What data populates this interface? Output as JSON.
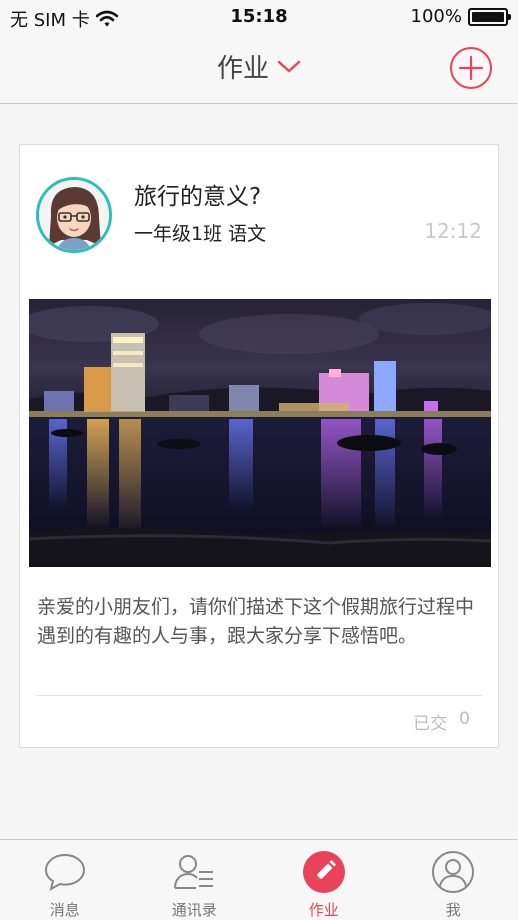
{
  "status_bar": {
    "carrier": "无 SIM 卡",
    "time": "15:18",
    "battery": "100%",
    "battery_level": 1.0
  },
  "nav": {
    "title": "作业",
    "icons": [
      "chevron-down-icon",
      "plus-circle-icon"
    ]
  },
  "card": {
    "title": "旅行的意义?",
    "meta": "一年级1班 语文",
    "time": "12:12",
    "description": "亲爱的小朋友们，请你们描述下这个假期旅行过程中遇到的有趣的人与事，跟大家分享下感悟吧。",
    "submitted_label": "已交",
    "submitted_count": "0"
  },
  "tabs": [
    {
      "label": "消息",
      "icon": "chat-bubble-icon",
      "active": false
    },
    {
      "label": "通讯录",
      "icon": "contacts-icon",
      "active": false
    },
    {
      "label": "作业",
      "icon": "pencil-icon",
      "active": true
    },
    {
      "label": "我",
      "icon": "profile-icon",
      "active": false
    }
  ],
  "colors": {
    "accent": "#e8435a",
    "avatar_ring": "#2bc0b4",
    "bar_background": "#f7f7f7",
    "page_background": "#f5f5f5"
  }
}
